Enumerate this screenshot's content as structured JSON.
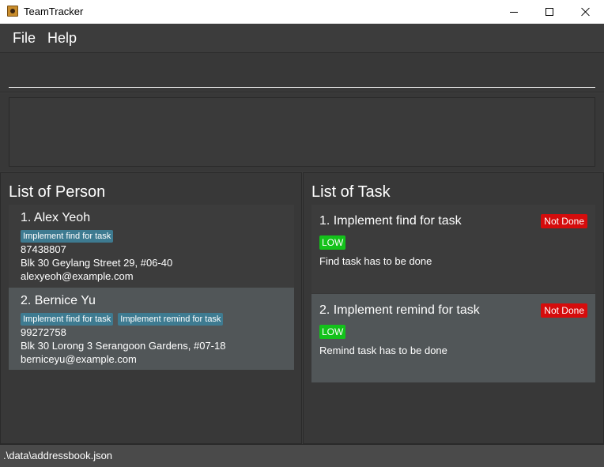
{
  "window": {
    "title": "TeamTracker"
  },
  "menu": {
    "file": "File",
    "help": "Help"
  },
  "command": {
    "value": "",
    "placeholder": ""
  },
  "result": {
    "text": ""
  },
  "persons": {
    "title": "List of Person",
    "items": [
      {
        "name": "1.  Alex Yeoh",
        "tags": [
          "Implement find for task"
        ],
        "phone": "87438807",
        "address": "Blk 30 Geylang Street 29, #06-40",
        "email": "alexyeoh@example.com"
      },
      {
        "name": "2.  Bernice Yu",
        "tags": [
          "Implement find for task",
          "Implement remind for task"
        ],
        "phone": "99272758",
        "address": "Blk 30 Lorong 3 Serangoon Gardens, #07-18",
        "email": "berniceyu@example.com"
      }
    ]
  },
  "tasks": {
    "title": "List of Task",
    "items": [
      {
        "title": "1. Implement find for task",
        "status": "Not Done",
        "priority": "LOW",
        "description": "Find task has to be done"
      },
      {
        "title": "2. Implement remind for task",
        "status": "Not Done",
        "priority": "LOW",
        "description": "Remind task has to be done"
      }
    ]
  },
  "statusbar": {
    "path": ".\\data\\addressbook.json"
  },
  "colors": {
    "background": "#3c3c3c",
    "tag": "#3e7b91",
    "not_done": "#d50c0c",
    "low_priority": "#13c21a",
    "selected_card": "#515658"
  }
}
